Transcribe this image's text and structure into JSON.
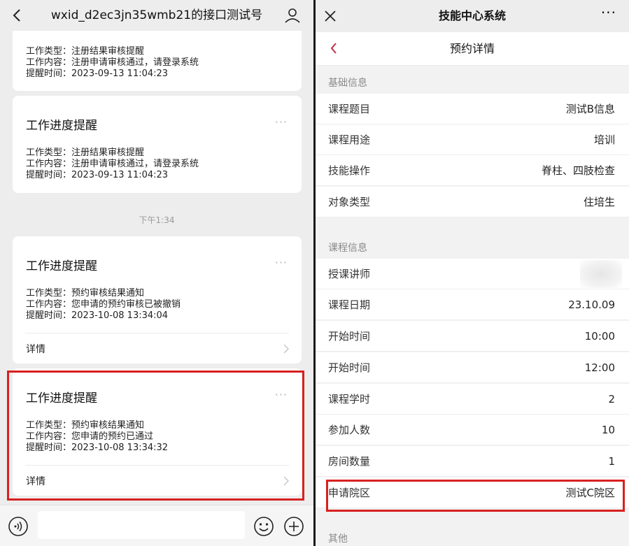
{
  "left": {
    "header_title": "wxid_d2ec3jn35wmb21的接口测试号",
    "timestamp": "下午1:34",
    "cards": [
      {
        "title": "",
        "lines": [
          "工作类型：注册结果审核提醒",
          "工作内容：注册申请审核通过，请登录系统",
          "提醒时间：2023-09-13 11:04:23"
        ]
      },
      {
        "title": "工作进度提醒",
        "lines": [
          "工作类型：注册结果审核提醒",
          "工作内容：注册申请审核通过，请登录系统",
          "提醒时间：2023-09-13 11:04:23"
        ]
      },
      {
        "title": "工作进度提醒",
        "lines": [
          "工作类型：预约审核结果通知",
          "工作内容：您申请的预约审核已被撤销",
          "提醒时间：2023-10-08 13:34:04"
        ],
        "detail": "详情"
      },
      {
        "title": "工作进度提醒",
        "lines": [
          "工作类型：预约审核结果通知",
          "工作内容：您申请的预约已通过",
          "提醒时间：2023-10-08 13:34:32"
        ],
        "detail": "详情"
      }
    ],
    "more_glyph": "···"
  },
  "right": {
    "header_title": "技能中心系统",
    "more_glyph": "···",
    "sub_title": "预约详情",
    "sections": [
      {
        "label": "基础信息",
        "rows": [
          {
            "label": "课程题目",
            "value": "测试B信息"
          },
          {
            "label": "课程用途",
            "value": "培训"
          },
          {
            "label": "技能操作",
            "value": "脊柱、四肢检查"
          },
          {
            "label": "对象类型",
            "value": "住培生"
          }
        ]
      },
      {
        "label": "课程信息",
        "rows": [
          {
            "label": "授课讲师",
            "value": ""
          },
          {
            "label": "课程日期",
            "value": "23.10.09"
          },
          {
            "label": "开始时间",
            "value": "10:00"
          },
          {
            "label": "开始时间",
            "value": "12:00"
          },
          {
            "label": "课程学时",
            "value": "2"
          },
          {
            "label": "参加人数",
            "value": "10"
          },
          {
            "label": "房间数量",
            "value": "1"
          },
          {
            "label": "申请院区",
            "value": "测试C院区"
          }
        ]
      },
      {
        "label": "其他",
        "rows": []
      }
    ]
  },
  "colors": {
    "highlight": "#d82020",
    "accent_back": "#c0304a"
  }
}
